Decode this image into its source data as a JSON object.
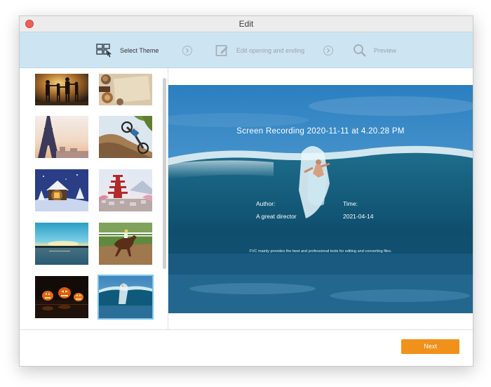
{
  "window": {
    "title": "Edit"
  },
  "steps": [
    {
      "label": "Select Theme",
      "icon": "theme-grid-icon"
    },
    {
      "label": "Edit opening and ending",
      "icon": "edit-icon"
    },
    {
      "label": "Preview",
      "icon": "search-icon"
    }
  ],
  "preview": {
    "title": "Screen Recording 2020-11-11 at 4.20.28 PM",
    "author_label": "Author:",
    "author_value": "A great director",
    "time_label": "Time:",
    "time_value": "2021-04-14",
    "footer": "FVC mainly provides the best and professional tools for editing and converting files."
  },
  "footer": {
    "next_label": "Next"
  },
  "colors": {
    "accent": "#f0911c",
    "step_bar": "#cde5f3",
    "selected_border": "#7fc6ea",
    "close": "#ee5e57"
  },
  "themes": {
    "selected": "surfer-wave",
    "items": [
      "family-sunset",
      "vintage-paper",
      "eiffel-tower",
      "motocross",
      "snowy-cabin",
      "pagoda-city",
      "lake-sunset",
      "horse-racing",
      "halloween-pumpkins",
      "surfer-wave"
    ]
  }
}
